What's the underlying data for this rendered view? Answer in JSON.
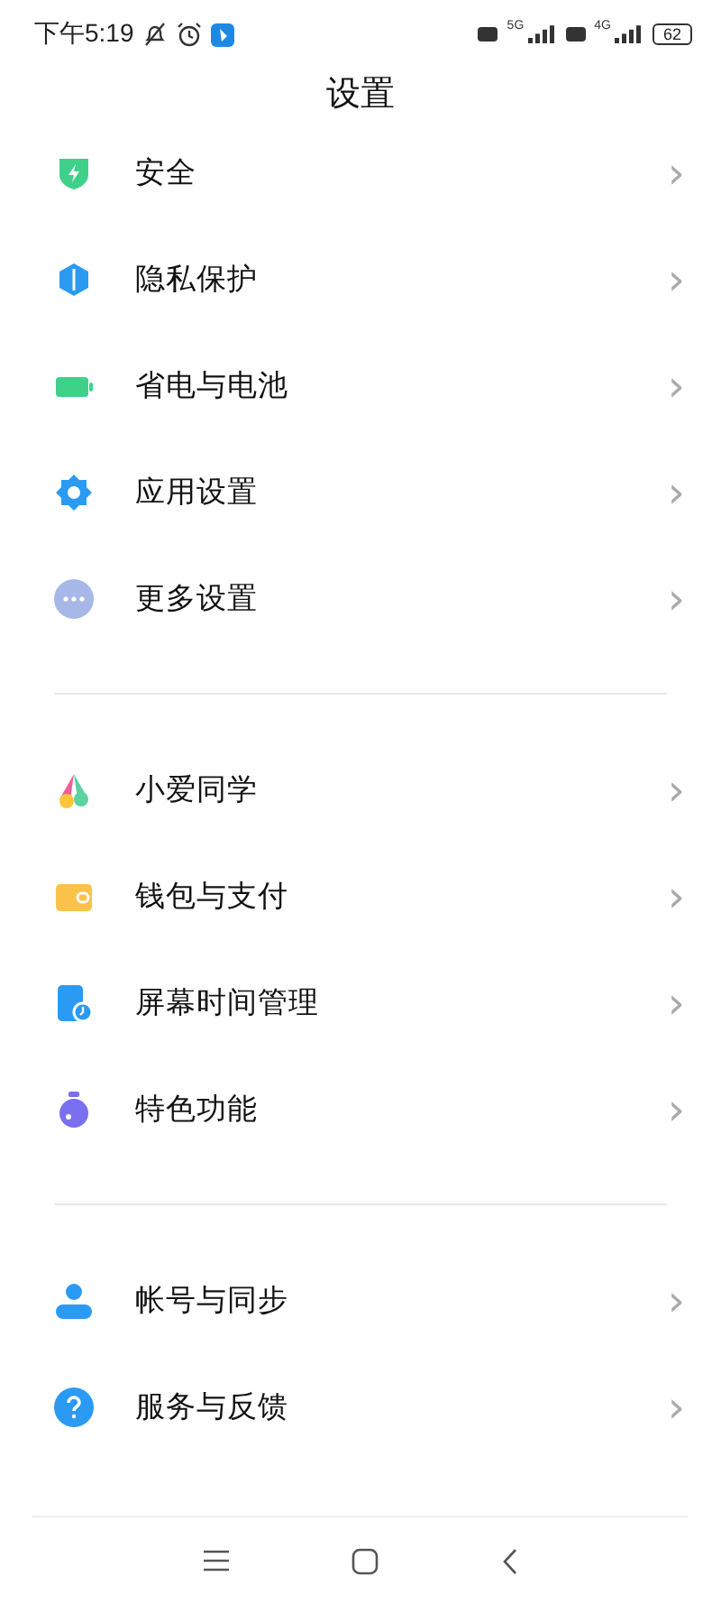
{
  "status_bar": {
    "time": "下午5:19",
    "sim_1": "5G",
    "sim_2": "4G",
    "battery": "62"
  },
  "title": "设置",
  "sections": [
    {
      "items": [
        {
          "label": "安全",
          "chevron": "›"
        },
        {
          "label": "隐私保护",
          "chevron": "›"
        },
        {
          "label": "省电与电池",
          "chevron": "›"
        },
        {
          "label": "应用设置",
          "chevron": "›"
        },
        {
          "label": "更多设置",
          "chevron": "›"
        }
      ]
    },
    {
      "items": [
        {
          "label": "小爱同学",
          "chevron": "›"
        },
        {
          "label": "钱包与支付",
          "chevron": "›"
        },
        {
          "label": "屏幕时间管理",
          "chevron": "›"
        },
        {
          "label": "特色功能",
          "chevron": "›"
        }
      ]
    },
    {
      "items": [
        {
          "label": "帐号与同步",
          "chevron": "›"
        },
        {
          "label": "服务与反馈",
          "chevron": "›"
        }
      ]
    }
  ]
}
